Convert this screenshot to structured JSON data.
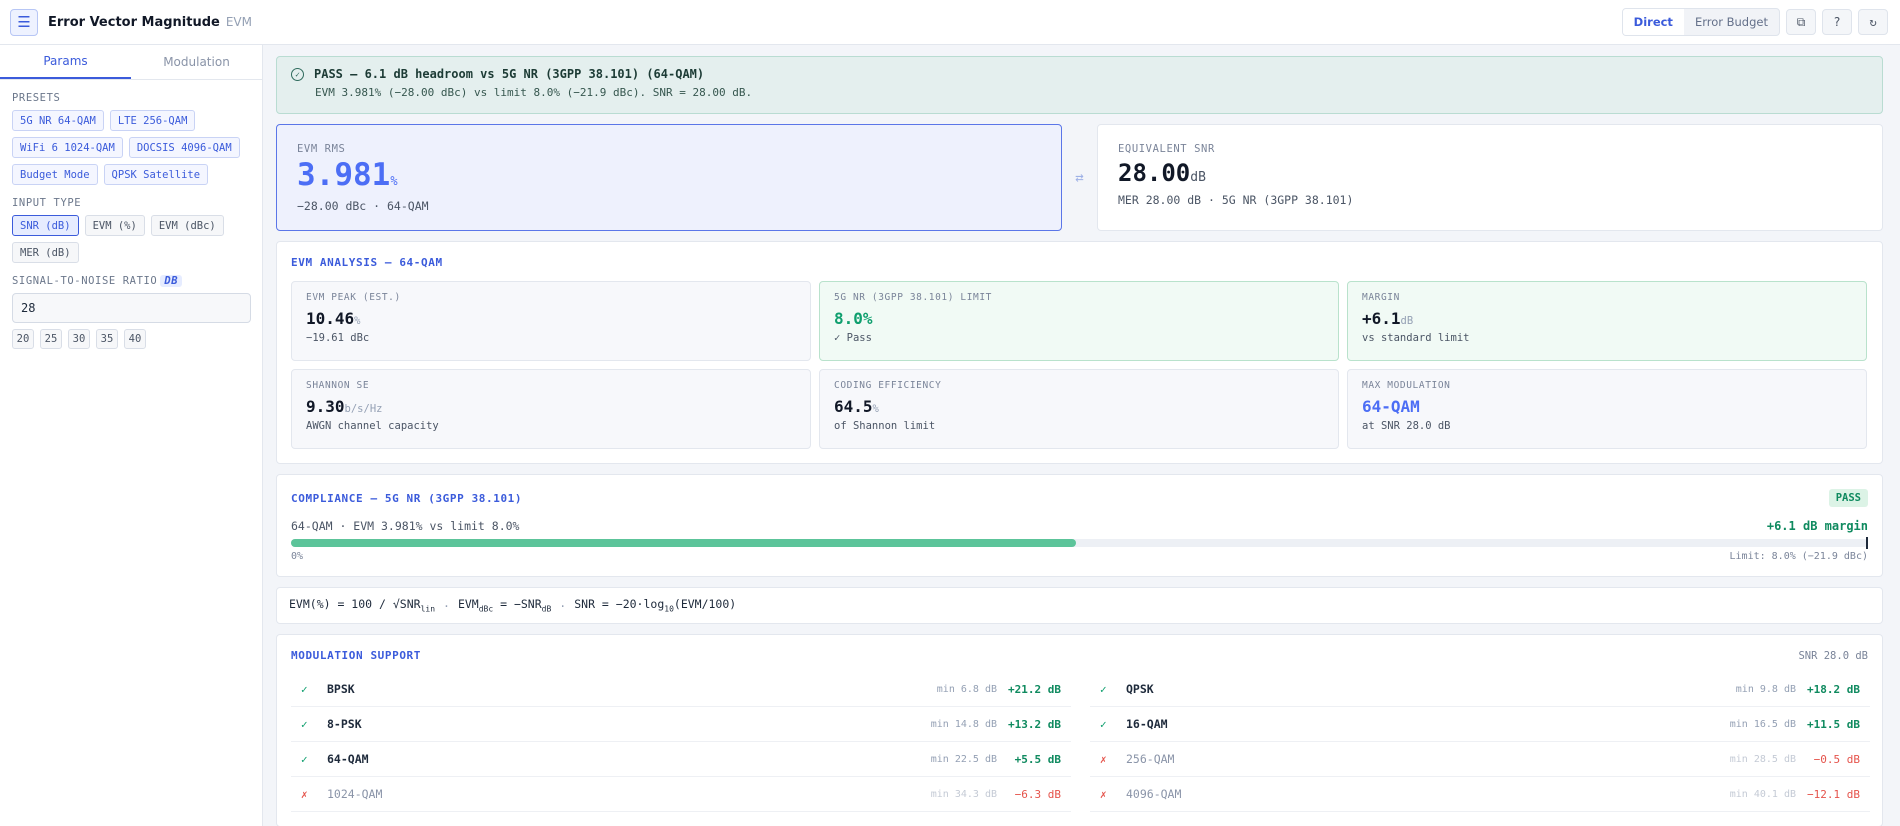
{
  "app": {
    "title": "Error Vector Magnitude",
    "subtitle": "EVM"
  },
  "topbar": {
    "modes": [
      "Direct",
      "Error Budget"
    ],
    "active_mode": "Direct",
    "icons": [
      "copy-icon",
      "help-icon",
      "refresh-icon"
    ]
  },
  "sidebar": {
    "tabs": [
      "Params",
      "Modulation"
    ],
    "active_tab": "Params",
    "presets_label": "PRESETS",
    "presets": [
      "5G NR 64-QAM",
      "LTE 256-QAM",
      "WiFi 6 1024-QAM",
      "DOCSIS 4096-QAM",
      "Budget Mode",
      "QPSK Satellite"
    ],
    "input_type_label": "INPUT TYPE",
    "input_types": [
      "SNR (dB)",
      "EVM (%)",
      "EVM (dBc)",
      "MER (dB)"
    ],
    "selected_input_type": "SNR (dB)",
    "snr_label": "SIGNAL-TO-NOISE RATIO",
    "snr_unit": "DB",
    "snr_value": "28",
    "quick_values": [
      "20",
      "25",
      "30",
      "35",
      "40"
    ]
  },
  "banner": {
    "headline": "PASS — 6.1 dB headroom vs 5G NR (3GPP 38.101) (64-QAM)",
    "detail": "EVM 3.981% (−28.00 dBc) vs limit 8.0% (−21.9 dBc). SNR = 28.00 dB."
  },
  "evm_card": {
    "label": "EVM RMS",
    "value": "3.981",
    "unit": "%",
    "sub": "−28.00 dBc · 64-QAM"
  },
  "snr_card": {
    "label": "EQUIVALENT SNR",
    "value": "28.00",
    "unit": "dB",
    "sub": "MER 28.00 dB · 5G NR (3GPP 38.101)"
  },
  "analysis": {
    "title": "EVM ANALYSIS — 64-QAM",
    "cells": [
      {
        "label": "EVM PEAK (EST.)",
        "value": "10.46",
        "unit": "%",
        "sub": "−19.61 dBc"
      },
      {
        "label": "5G NR (3GPP 38.101) LIMIT",
        "value": "8.0%",
        "unit": "",
        "sub": "✓ Pass"
      },
      {
        "label": "MARGIN",
        "value": "+6.1",
        "unit": "dB",
        "sub": "vs standard limit"
      },
      {
        "label": "SHANNON SE",
        "value": "9.30",
        "unit": "b/s/Hz",
        "sub": "AWGN channel capacity"
      },
      {
        "label": "CODING EFFICIENCY",
        "value": "64.5",
        "unit": "%",
        "sub": "of Shannon limit"
      },
      {
        "label": "MAX MODULATION",
        "value": "64-QAM",
        "unit": "",
        "sub": "at SNR 28.0 dB"
      }
    ]
  },
  "compliance": {
    "title": "COMPLIANCE — 5G NR (3GPP 38.101)",
    "badge": "PASS",
    "summary": "64-QAM · EVM 3.981% vs limit 8.0%",
    "margin": "+6.1 dB margin",
    "fill_fraction": 0.498,
    "scale_min": "0%",
    "scale_max": "Limit: 8.0% (−21.9 dBc)"
  },
  "formula": {
    "f1_pre": "EVM(%) = 100 / √SNR",
    "f1_sub": "lin",
    "f2_pre": "EVM",
    "f2_sub1": "dBc",
    "f2_mid": " = −SNR",
    "f2_sub2": "dB",
    "f3_pre": "SNR = −20·log",
    "f3_sub": "10",
    "f3_post": "(EVM/100)",
    "sep": "·"
  },
  "modulation": {
    "title": "MODULATION SUPPORT",
    "snr": "SNR 28.0 dB",
    "rows": [
      {
        "name": "BPSK",
        "min": "min 6.8 dB",
        "margin": "+21.2 dB",
        "ok": true
      },
      {
        "name": "QPSK",
        "min": "min 9.8 dB",
        "margin": "+18.2 dB",
        "ok": true
      },
      {
        "name": "8-PSK",
        "min": "min 14.8 dB",
        "margin": "+13.2 dB",
        "ok": true
      },
      {
        "name": "16-QAM",
        "min": "min 16.5 dB",
        "margin": "+11.5 dB",
        "ok": true
      },
      {
        "name": "64-QAM",
        "min": "min 22.5 dB",
        "margin": "+5.5 dB",
        "ok": true
      },
      {
        "name": "256-QAM",
        "min": "min 28.5 dB",
        "margin": "−0.5 dB",
        "ok": false
      },
      {
        "name": "1024-QAM",
        "min": "min 34.3 dB",
        "margin": "−6.3 dB",
        "ok": false
      },
      {
        "name": "4096-QAM",
        "min": "min 40.1 dB",
        "margin": "−12.1 dB",
        "ok": false
      }
    ],
    "ok_mark": "✓",
    "fail_mark": "✗"
  },
  "colors": {
    "accent": "#3b5bdb",
    "pass": "#0f8a5f",
    "fail": "#e5534b"
  }
}
